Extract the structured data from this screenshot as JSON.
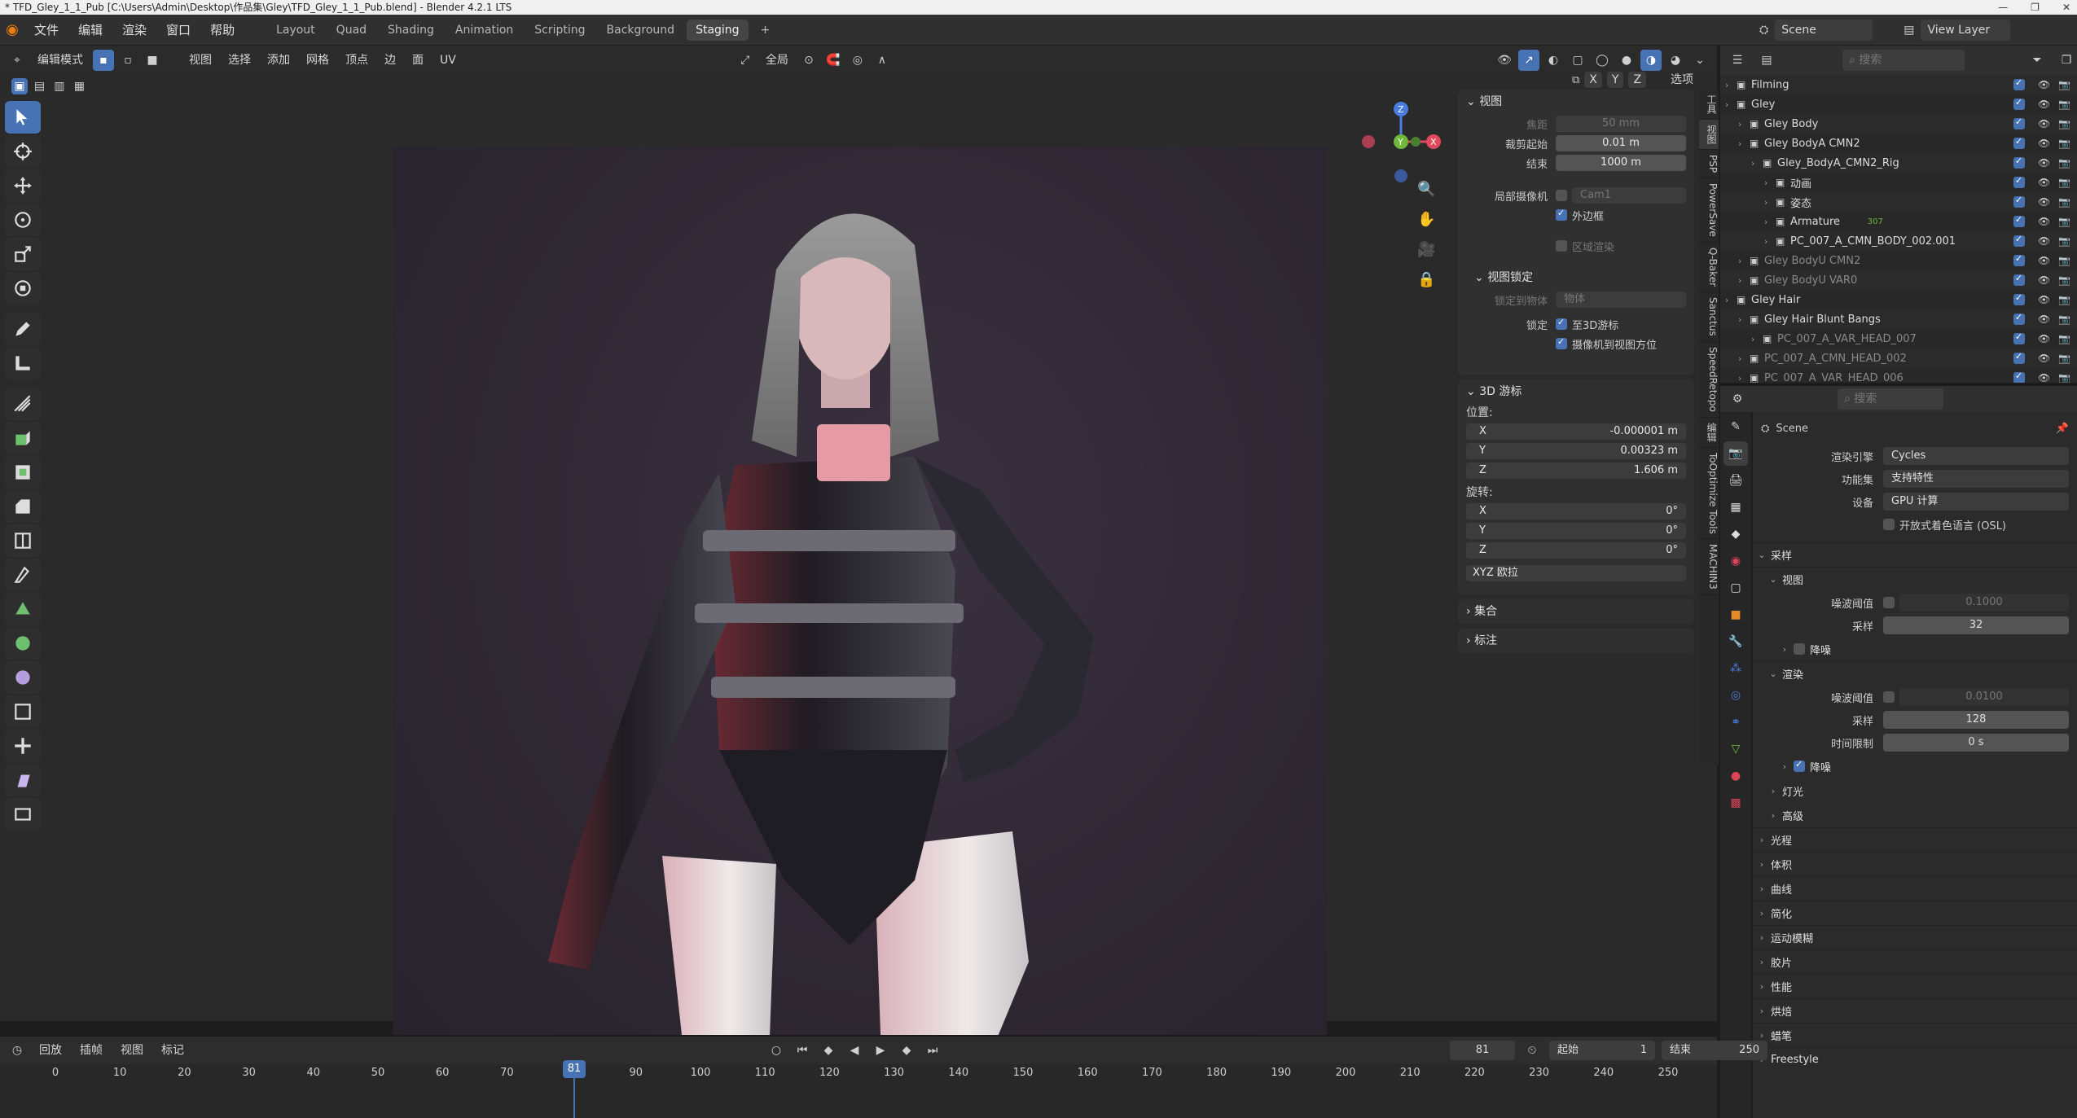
{
  "window": {
    "title": "* TFD_Gley_1_1_Pub [C:\\Users\\Admin\\Desktop\\作品集\\Gley\\TFD_Gley_1_1_Pub.blend] - Blender 4.2.1 LTS"
  },
  "menubar": {
    "menus": [
      "文件",
      "编辑",
      "渲染",
      "窗口",
      "帮助"
    ],
    "workspaces": [
      "Layout",
      "Quad",
      "Shading",
      "Animation",
      "Scripting",
      "Background",
      "Staging"
    ],
    "active_workspace": "Staging",
    "add_tab": "+",
    "scene_label": "Scene",
    "view_layer_label": "View Layer"
  },
  "viewport_header": {
    "mode": "编辑模式",
    "menus": [
      "视图",
      "选择",
      "添加",
      "网格",
      "顶点",
      "边",
      "面",
      "UV"
    ],
    "transform": "全局",
    "axes": [
      "X",
      "Y",
      "Z"
    ],
    "options": "选项"
  },
  "npanel": {
    "view": {
      "title": "视图",
      "focal_label": "焦距",
      "focal_value": "50 mm",
      "clip_start_label": "裁剪起始",
      "clip_start_value": "0.01 m",
      "clip_end_label": "结束",
      "clip_end_value": "1000 m",
      "local_camera_label": "局部摄像机",
      "local_camera_value": "Cam1",
      "border_label": "外边框",
      "region_render_label": "区域渲染"
    },
    "view_lock": {
      "title": "视图锁定",
      "lock_object_label": "锁定到物体",
      "lock_object_placeholder": "物体",
      "lock_label": "锁定",
      "to_3d_cursor": "至3D游标",
      "camera_to_view": "摄像机到视图方位"
    },
    "cursor": {
      "title": "3D 游标",
      "location_label": "位置:",
      "rotation_label": "旋转:",
      "loc_x": "-0.000001 m",
      "loc_y": "0.00323 m",
      "loc_z": "1.606 m",
      "rot_x": "0°",
      "rot_y": "0°",
      "rot_z": "0°",
      "axis_x": "X",
      "axis_y": "Y",
      "axis_z": "Z",
      "rotation_mode": "XYZ 欧拉"
    },
    "collection": "集合",
    "annotations": "标注"
  },
  "vtabs": [
    "工具",
    "视图",
    "PSP",
    "PowerSave",
    "Q-Baker",
    "Sanctus",
    "SpeedRetopo",
    "编辑",
    "ToOptimize Tools",
    "MACHIN3"
  ],
  "outliner": {
    "search_placeholder": "搜索",
    "rows": [
      {
        "name": "Filming",
        "indent": 0,
        "dim": false
      },
      {
        "name": "Gley",
        "indent": 0,
        "dim": false
      },
      {
        "name": "Gley Body",
        "indent": 1,
        "dim": false
      },
      {
        "name": "Gley BodyA CMN2",
        "indent": 1,
        "dim": false
      },
      {
        "name": "Gley_BodyA_CMN2_Rig",
        "indent": 2,
        "dim": false
      },
      {
        "name": "动画",
        "indent": 3,
        "dim": false
      },
      {
        "name": "姿态",
        "indent": 3,
        "dim": false
      },
      {
        "name": "Armature",
        "indent": 3,
        "dim": false
      },
      {
        "name": "PC_007_A_CMN_BODY_002.001",
        "indent": 3,
        "dim": false
      },
      {
        "name": "Gley BodyU CMN2",
        "indent": 1,
        "dim": true
      },
      {
        "name": "Gley BodyU VAR0",
        "indent": 1,
        "dim": true
      },
      {
        "name": "Gley Hair",
        "indent": 0,
        "dim": false
      },
      {
        "name": "Gley Hair Blunt Bangs",
        "indent": 1,
        "dim": false
      },
      {
        "name": "PC_007_A_VAR_HEAD_007",
        "indent": 2,
        "dim": true
      },
      {
        "name": "PC_007_A_CMN_HEAD_002",
        "indent": 1,
        "dim": true
      },
      {
        "name": "PC_007_A_VAR_HEAD_006",
        "indent": 1,
        "dim": true
      }
    ],
    "armature_count": "307"
  },
  "properties": {
    "search_placeholder": "搜索",
    "scene": "Scene",
    "render_engine_label": "渲染引擎",
    "render_engine": "Cycles",
    "feature_set_label": "功能集",
    "feature_set": "支持特性",
    "device_label": "设备",
    "device": "GPU 计算",
    "osl_label": "开放式着色语言 (OSL)",
    "sampling": "采样",
    "viewport": "视图",
    "noise_threshold_label": "噪波阈值",
    "vp_noise_threshold": "0.1000",
    "samples_label": "采样",
    "vp_samples": "32",
    "denoise_label": "降噪",
    "render": "渲染",
    "r_noise_threshold": "0.0100",
    "r_samples": "128",
    "time_limit_label": "时间限制",
    "time_limit": "0 s",
    "lights": "灯光",
    "advanced": "高级",
    "sections": [
      "光程",
      "体积",
      "曲线",
      "简化",
      "运动模糊",
      "胶片",
      "性能",
      "烘焙",
      "蜡笔",
      "Freestyle"
    ]
  },
  "timeline": {
    "menus": [
      "回放",
      "插帧",
      "视图",
      "标记"
    ],
    "current_frame": "81",
    "start_label": "起始",
    "start": "1",
    "end_label": "结束",
    "end": "250",
    "ticks": [
      "0",
      "10",
      "20",
      "30",
      "40",
      "50",
      "60",
      "70",
      "80",
      "90",
      "100",
      "110",
      "120",
      "130",
      "140",
      "150",
      "160",
      "170",
      "180",
      "190",
      "200",
      "210",
      "220",
      "230",
      "240",
      "250"
    ]
  },
  "colors": {
    "accent": "#4772b3",
    "axis_x": "#e04a5c",
    "axis_y": "#6fb83a",
    "axis_z": "#4a7ce0"
  }
}
